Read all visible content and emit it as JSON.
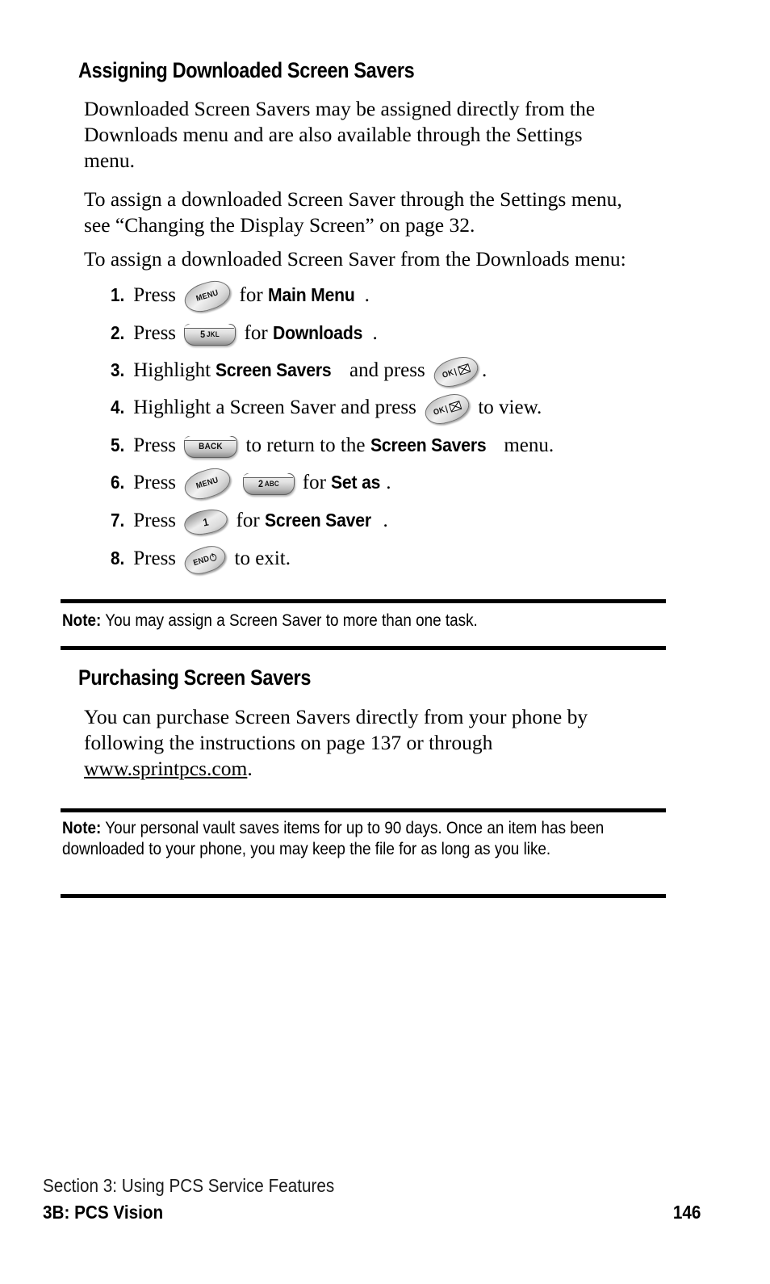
{
  "sections": {
    "assigning": {
      "heading": "Assigning Downloaded Screen Savers",
      "para_1": "Downloaded Screen Savers may be assigned directly from the Downloads menu and are also available through the Settings menu.",
      "para_2": "To assign a downloaded Screen Saver through the Settings menu, see “Changing the Display Screen” on page 32.",
      "para_3": "To assign a downloaded Screen Saver from the Downloads menu:"
    },
    "purchasing": {
      "heading": "Purchasing Screen Savers",
      "para_lead": "You can purchase Screen Savers directly from your phone by following the instructions on page 137 or through ",
      "link": "www.sprintpcs.com",
      "para_tail": "."
    }
  },
  "steps": [
    {
      "num": "1.",
      "pre": "Press",
      "keys": [
        {
          "icon": "menu-key",
          "label": "MENU",
          "style": "tilt"
        }
      ],
      "mid": "for",
      "emphasis": "Main Menu",
      "post": "."
    },
    {
      "num": "2.",
      "pre": "Press",
      "keys": [
        {
          "icon": "five-jkl-key",
          "label": "5",
          "sub": "JKL",
          "style": "flat"
        }
      ],
      "mid": "for",
      "emphasis": "Downloads",
      "post": "."
    },
    {
      "num": "3.",
      "pre": "Highlight",
      "emphasis": "Screen Savers",
      "mid": "and press",
      "keys": [
        {
          "icon": "ok-key",
          "label": "OK",
          "style": "tilt-ok"
        }
      ],
      "post": "."
    },
    {
      "num": "4.",
      "pre": "Highlight a Screen Saver and press",
      "keys": [
        {
          "icon": "ok-key",
          "label": "OK",
          "style": "tilt-ok"
        }
      ],
      "post": "to view."
    },
    {
      "num": "5.",
      "pre": "Press",
      "keys": [
        {
          "icon": "back-key",
          "label": "BACK",
          "style": "flat"
        }
      ],
      "mid": "to return to the",
      "emphasis": "Screen Savers",
      "post": "menu."
    },
    {
      "num": "6.",
      "pre": "Press",
      "keys": [
        {
          "icon": "menu-key",
          "label": "MENU",
          "style": "tilt"
        },
        {
          "icon": "two-abc-key",
          "label": "2",
          "sub": "ABC",
          "style": "flat"
        }
      ],
      "mid": "for",
      "emphasis": "Set as",
      "post": "."
    },
    {
      "num": "7.",
      "pre": "Press",
      "keys": [
        {
          "icon": "one-key",
          "label": "1",
          "style": "tilt-one"
        }
      ],
      "mid": "for",
      "emphasis": "Screen Saver",
      "post": "."
    },
    {
      "num": "8.",
      "pre": "Press",
      "keys": [
        {
          "icon": "end-key",
          "label": "END",
          "style": "tilt-end"
        }
      ],
      "post": "to exit."
    }
  ],
  "notes": [
    {
      "label": "Note:",
      "text": " You may assign a Screen Saver to more than one task."
    },
    {
      "label": "Note:",
      "text": " Your personal vault saves items for up to 90 days. Once an item has been downloaded to your phone, you may keep the file for as long as you like."
    }
  ],
  "footer": {
    "section": "Section 3: Using PCS Service Features",
    "chapter": "3B: PCS Vision",
    "page_number": "146"
  },
  "colors": {
    "text": "#000000",
    "rule": "#000000",
    "background": "#ffffff"
  }
}
